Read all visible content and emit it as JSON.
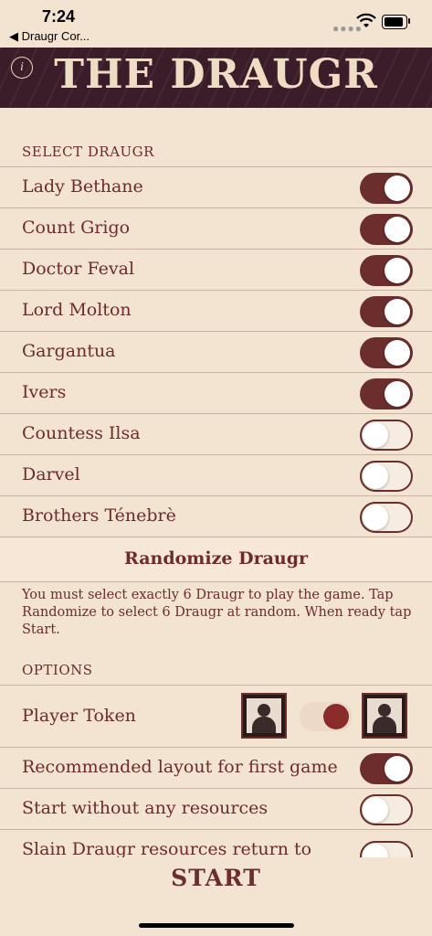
{
  "status": {
    "time": "7:24",
    "back_label": "◀ Draugr Cor..."
  },
  "banner": {
    "title": "THE DRAUGR",
    "info_icon": "info-icon"
  },
  "select": {
    "header": "SELECT DRAUGR",
    "items": [
      {
        "label": "Lady Bethane",
        "on": true
      },
      {
        "label": "Count Grigo",
        "on": true
      },
      {
        "label": "Doctor Feval",
        "on": true
      },
      {
        "label": "Lord Molton",
        "on": true
      },
      {
        "label": "Gargantua",
        "on": true
      },
      {
        "label": "Ivers",
        "on": true
      },
      {
        "label": "Countess Ilsa",
        "on": false
      },
      {
        "label": "Darvel",
        "on": false
      },
      {
        "label": "Brothers Ténebrè",
        "on": false
      }
    ],
    "randomize_label": "Randomize Draugr",
    "help": "You must select exactly 6 Draugr to play the game. Tap Randomize to select 6 Draugr at random. When ready tap Start."
  },
  "options": {
    "header": "OPTIONS",
    "player_token_label": "Player Token",
    "items": [
      {
        "label": "Recommended layout for first game",
        "on": true
      },
      {
        "label": "Start without any resources",
        "on": false
      },
      {
        "label": "Slain Draugr resources return to",
        "on": false
      }
    ]
  },
  "start_label": "START",
  "colors": {
    "accent": "#6b2e2d",
    "background": "#f3e3d1"
  }
}
